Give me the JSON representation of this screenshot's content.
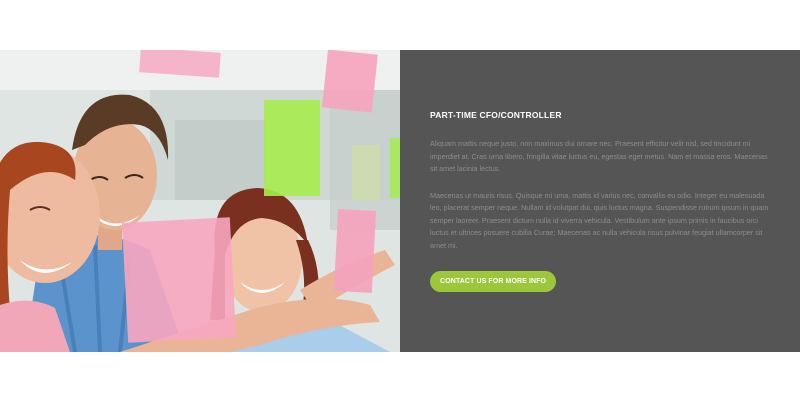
{
  "section": {
    "heading": "PART-TIME CFO/CONTROLLER",
    "paragraph_1": "Aliquam mattis neque justo, non maximus dui ornare nec. Praesent efficitur velit nisl, sed tincidunt mi imperdiet at. Cras urna libero, fringilla vitae luctus eu, egestas eget metus. Nam et massa eros. Maecenas sit amet lacinia lectus.",
    "paragraph_2": "Maecenas ut mauris risus. Quisque mi uma, mattis id varius nec, convallis eu odio. Integer eu malesuada leo, placerat semper neque. Nullam id volutpat dui, quis luctus magna. Suspendisse rutrum ipsum in quam semper laoreet. Praesent dictum nulla id viverra vehicula. Vestibulum ante ipsum primis in faucibus orci luctus et ultrices posuere cubilia Curae; Maecenas ac nulla vehicula risus pulvinar feugiat ullamcorper sit amet mi.",
    "cta_label": "CONTACT US FOR MORE INFO"
  },
  "colors": {
    "panel_bg": "#555555",
    "accent_green": "#9cc63b",
    "heading_text": "#ffffff",
    "body_text": "#8d8d8d"
  },
  "image": {
    "subject": "team-brainstorm-sticky-notes-photo"
  }
}
